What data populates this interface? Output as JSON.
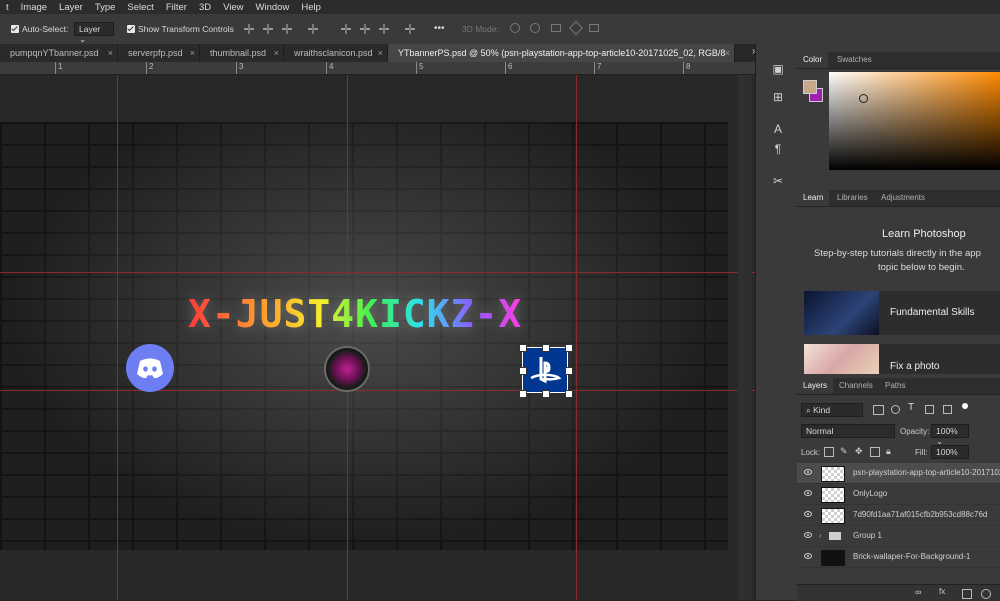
{
  "menu": [
    "t",
    "Image",
    "Layer",
    "Type",
    "Select",
    "Filter",
    "3D",
    "View",
    "Window",
    "Help"
  ],
  "options": {
    "auto_select_label": "Auto-Select:",
    "auto_select_value": "Layer",
    "show_transform_label": "Show Transform Controls",
    "more": "•••",
    "mode_3d": "3D Mode:"
  },
  "tabs": [
    {
      "label": "pumpqnYTbanner.psd",
      "close": "×"
    },
    {
      "label": "serverpfp.psd",
      "close": "×"
    },
    {
      "label": "thumbnail.psd",
      "close": "×"
    },
    {
      "label": "wraithsclanicon.psd",
      "close": "×"
    },
    {
      "label": "YTbannerPS.psd @ 50% (psn-playstation-app-top-article10-20171025_02, RGB/8",
      "close": "×"
    }
  ],
  "collapse_glyph": "»",
  "ruler_numbers": [
    "1",
    "2",
    "3",
    "4",
    "5",
    "6",
    "7",
    "8"
  ],
  "canvas": {
    "title": "X-JUST4KICKZ-X"
  },
  "color_panel": {
    "tabs": [
      "Color",
      "Swatches"
    ],
    "fg_color": "#c9a88a",
    "bg_color": "#a020b0"
  },
  "learn_panel": {
    "tabs": [
      "Learn",
      "Libraries",
      "Adjustments"
    ],
    "title": "Learn Photoshop",
    "subtitle_line1": "Step-by-step tutorials directly in the app",
    "subtitle_line2": "topic below to begin.",
    "cards": [
      "Fundamental Skills",
      "Fix a photo"
    ]
  },
  "layers_panel": {
    "tabs": [
      "Layers",
      "Channels",
      "Paths"
    ],
    "kind_label": "Kind",
    "blend_mode": "Normal",
    "opacity_label": "Opacity:",
    "opacity_value": "100%",
    "lock_label": "Lock:",
    "fill_label": "Fill:",
    "fill_value": "100%",
    "layers": [
      {
        "name": "psn-playstation-app-top-article10-20171025_",
        "selected": true
      },
      {
        "name": "OnlyLogo",
        "selected": false
      },
      {
        "name": "7d90fd1aa71af015cfb2b953cd88c76d",
        "selected": false
      },
      {
        "name": "Group 1",
        "selected": false
      },
      {
        "name": "Brick-wallaper-For-Background-1",
        "selected": false
      }
    ],
    "footer_icons": [
      "fx"
    ]
  }
}
